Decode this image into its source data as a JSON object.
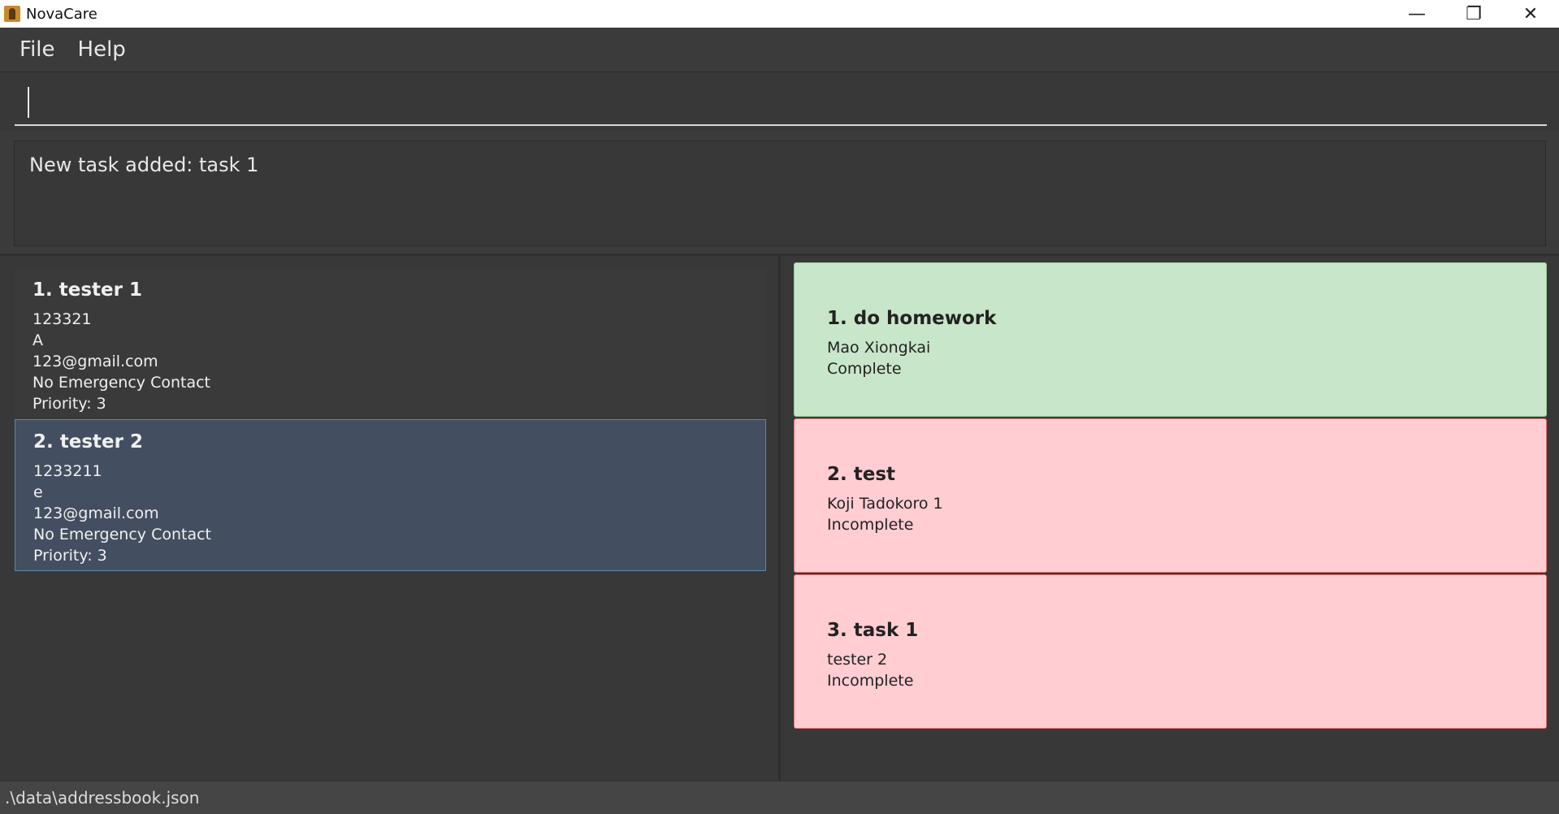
{
  "window": {
    "title": "NovaCare",
    "app_icon": "novacare-app-icon",
    "controls": {
      "minimize": "—",
      "restore": "❐",
      "close": "✕"
    }
  },
  "menu": {
    "file": "File",
    "help": "Help"
  },
  "command": {
    "value": "",
    "placeholder": ""
  },
  "result": {
    "message": "New task added: task 1"
  },
  "persons": [
    {
      "name": "1. tester 1",
      "phone": "123321",
      "address": "A",
      "email": "123@gmail.com",
      "emergency": "No Emergency Contact",
      "priority": "Priority: 3"
    },
    {
      "name": "2. tester 2",
      "phone": "1233211",
      "address": "e",
      "email": "123@gmail.com",
      "emergency": "No Emergency Contact",
      "priority": "Priority: 3"
    }
  ],
  "tasks": [
    {
      "title": "1. do homework",
      "person": "Mao Xiongkai",
      "status": "Complete"
    },
    {
      "title": "2. test",
      "person": "Koji Tadokoro 1",
      "status": "Incomplete"
    },
    {
      "title": "3. task 1",
      "person": "tester 2",
      "status": "Incomplete"
    }
  ],
  "colors": {
    "complete_bg": "#c8e6c9",
    "incomplete_bg": "#ffcdd2",
    "selected_bg": "#434e60"
  },
  "status_bar": {
    "path": ".\\data\\addressbook.json"
  }
}
